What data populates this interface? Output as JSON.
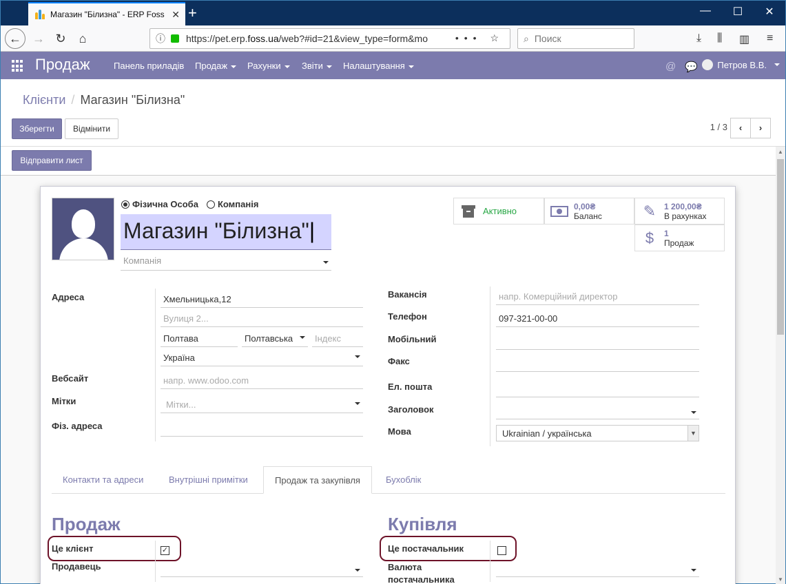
{
  "browser": {
    "tab_title": "Магазин \"Білизна\" - ERP Foss",
    "url_prefix": "https://pet.erp.",
    "url_domain": "foss.ua",
    "url_suffix": "/web?#id=21&view_type=form&mo",
    "search_placeholder": "Поиск"
  },
  "app": {
    "brand": "Продаж",
    "menu": [
      "Панель приладів",
      "Продаж",
      "Рахунки",
      "Звіти",
      "Налаштування"
    ],
    "user": "Петров В.В."
  },
  "breadcrumb": {
    "parent": "Клієнти",
    "current": "Магазин \"Білизна\""
  },
  "buttons": {
    "save": "Зберегти",
    "discard": "Відмінити",
    "send_mail": "Відправити лист"
  },
  "pager": {
    "value": "1 / 3"
  },
  "partner": {
    "type_options": [
      "Фізична Особа",
      "Компанія"
    ],
    "type_selected": "Фізична Особа",
    "name": "Магазин \"Білизна\"",
    "company_placeholder": "Компанія"
  },
  "stats": {
    "active": "Активно",
    "balance_value": "0,00₴",
    "balance_label": "Баланс",
    "invoiced_value": "1 200,00₴",
    "invoiced_label": "В рахунках",
    "sales_value": "1",
    "sales_label": "Продаж"
  },
  "left_fields": {
    "address_label": "Адреса",
    "street": "Хмельницька,12",
    "street2_placeholder": "Вулиця 2...",
    "city": "Полтава",
    "state": "Полтавська",
    "zip_placeholder": "Індекс",
    "country": "Україна",
    "website_label": "Вебсайт",
    "website_placeholder": "напр. www.odoo.com",
    "tags_label": "Мітки",
    "tags_placeholder": "Мітки...",
    "phys_address_label": "Фіз. адреса"
  },
  "right_fields": {
    "function_label": "Вакансія",
    "function_placeholder": "напр. Комерційний директор",
    "phone_label": "Телефон",
    "phone": "097-321-00-00",
    "mobile_label": "Мобільний",
    "fax_label": "Факс",
    "email_label": "Ел. пошта",
    "title_label": "Заголовок",
    "lang_label": "Мова",
    "lang": "Ukrainian / українська"
  },
  "tabs": [
    "Контакти та адреси",
    "Внутрішні примітки",
    "Продаж та закупівля",
    "Бухоблік"
  ],
  "active_tab": "Продаж та закупівля",
  "sales": {
    "title": "Продаж",
    "customer_label": "Це клієнт",
    "customer_checked": true,
    "salesperson_label": "Продавець"
  },
  "purchase": {
    "title": "Купівля",
    "supplier_label": "Це постачальник",
    "supplier_checked": false,
    "currency_label_1": "Валюта",
    "currency_label_2": "постачальника"
  },
  "colors": {
    "primary": "#7c7bad",
    "highlight": "#6d1228"
  }
}
